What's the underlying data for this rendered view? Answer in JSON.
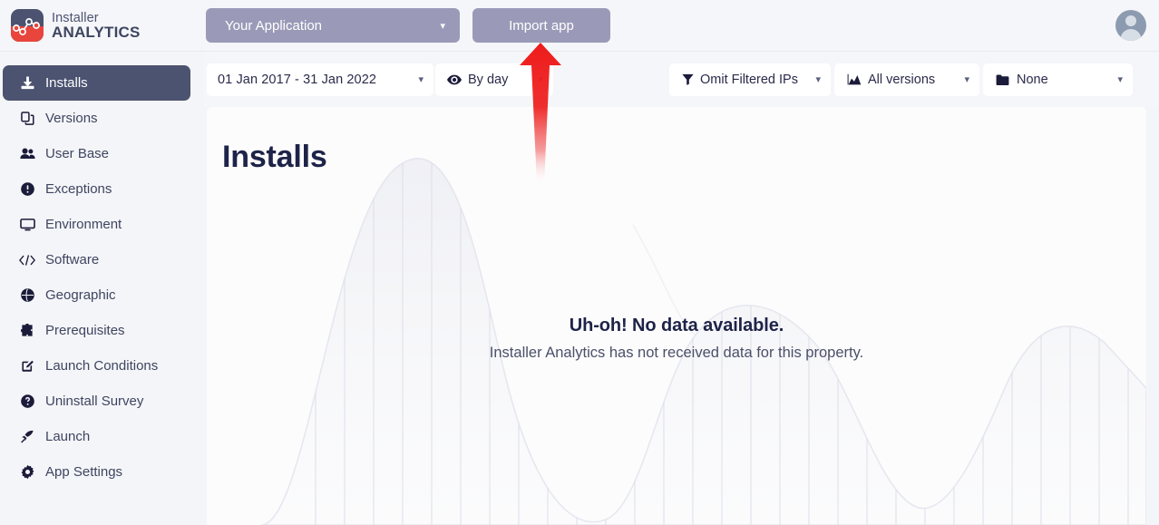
{
  "brand": {
    "logo_icon": "installer-analytics-logo",
    "line1": "Installer",
    "line2": "ANALYTICS"
  },
  "header": {
    "app_selector": {
      "label": "Your Application",
      "caret_icon": "chevron-down-icon"
    },
    "import_button": {
      "label": "Import app"
    },
    "avatar_icon": "user-avatar-icon",
    "button_color": "#9a9ab8"
  },
  "sidebar": {
    "items": [
      {
        "label": "Installs",
        "icon": "download-icon",
        "active": true
      },
      {
        "label": "Versions",
        "icon": "copy-versions-icon",
        "active": false
      },
      {
        "label": "User Base",
        "icon": "users-icon",
        "active": false
      },
      {
        "label": "Exceptions",
        "icon": "exclamation-circle-icon",
        "active": false
      },
      {
        "label": "Environment",
        "icon": "desktop-icon",
        "active": false
      },
      {
        "label": "Software",
        "icon": "code-icon",
        "active": false
      },
      {
        "label": "Geographic",
        "icon": "globe-icon",
        "active": false
      },
      {
        "label": "Prerequisites",
        "icon": "puzzle-piece-icon",
        "active": false
      },
      {
        "label": "Launch Conditions",
        "icon": "edit-square-icon",
        "active": false
      },
      {
        "label": "Uninstall Survey",
        "icon": "question-circle-icon",
        "active": false
      },
      {
        "label": "Launch",
        "icon": "rocket-icon",
        "active": false
      },
      {
        "label": "App Settings",
        "icon": "gear-icon",
        "active": false
      }
    ],
    "active_bg": "#4c5370"
  },
  "filters": {
    "date_range": {
      "start": "01 Jan 2017",
      "separator": "-",
      "end": "31 Jan 2022",
      "display": "01 Jan 2017  -  31 Jan 2022",
      "caret_icon": "chevron-down-icon"
    },
    "granularity": {
      "label": "By day",
      "icon": "eye-icon",
      "caret_icon": "chevron-down-icon"
    },
    "ip_filter": {
      "label": "Omit Filtered IPs",
      "icon": "funnel-filter-icon",
      "caret_icon": "chevron-down-icon"
    },
    "versions": {
      "label": "All versions",
      "icon": "area-chart-icon",
      "caret_icon": "chevron-down-icon"
    },
    "folder": {
      "label": "None",
      "icon": "folder-icon",
      "caret_icon": "chevron-down-icon"
    }
  },
  "main": {
    "title": "Installs",
    "empty_state": {
      "title": "Uh-oh! No data available.",
      "subtitle": "Installer Analytics has not received data for this property."
    },
    "background_watermark_icon": "faint-area-chart-watermark"
  },
  "annotation": {
    "arrow_icon": "red-up-arrow-annotation",
    "color": "#ee1c1c",
    "points_at": "Import app"
  }
}
